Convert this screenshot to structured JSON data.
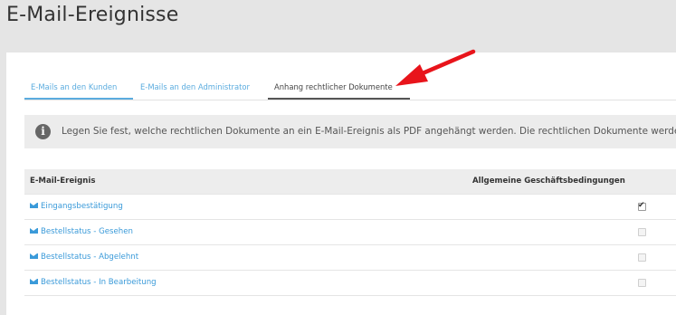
{
  "page": {
    "title": "E-Mail-Ereignisse"
  },
  "tabs": [
    {
      "label": "E-Mails an den Kunden",
      "active": false
    },
    {
      "label": "E-Mails an den Administrator",
      "active": false
    },
    {
      "label": "Anhang rechtlicher Dokumente",
      "active": true
    }
  ],
  "info": {
    "icon": "info-icon",
    "text": "Legen Sie fest, welche rechtlichen Dokumente an ein E-Mail-Ereignis als PDF angehängt werden. Die rechtlichen Dokumente werden"
  },
  "table": {
    "headers": {
      "event": "E-Mail-Ereignis",
      "terms": "Allgemeine Geschäftsbedingungen"
    },
    "rows": [
      {
        "label": "Eingangsbestätigung",
        "icon": "envelope-icon",
        "checked": true
      },
      {
        "label": "Bestellstatus - Gesehen",
        "icon": "envelope-icon",
        "checked": false
      },
      {
        "label": "Bestellstatus - Abgelehnt",
        "icon": "envelope-icon",
        "checked": false
      },
      {
        "label": "Bestellstatus - In Bearbeitung",
        "icon": "envelope-icon",
        "checked": false
      }
    ]
  },
  "annotation": {
    "arrow_color": "#e8141b",
    "icon": "red-arrow-icon"
  },
  "colors": {
    "accent": "#5bacdf",
    "link": "#3a9ad9",
    "background": "#e5e5e5"
  }
}
